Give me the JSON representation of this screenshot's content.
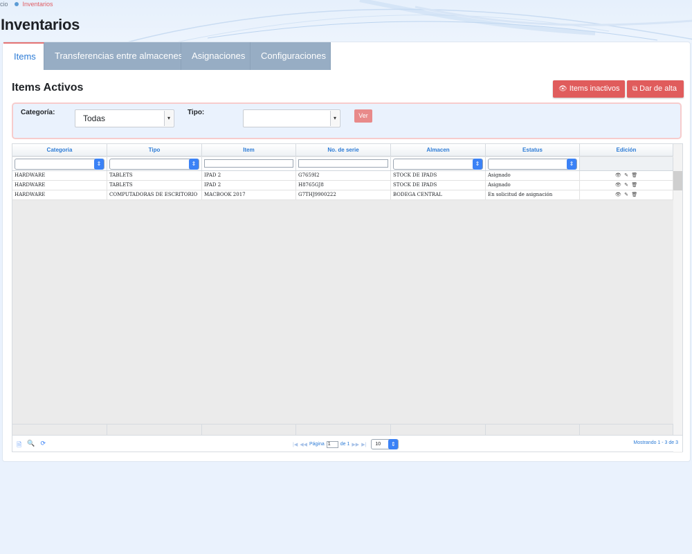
{
  "breadcrumb": {
    "home": "cio",
    "current": "Inventarios"
  },
  "page": {
    "title": "Inventarios"
  },
  "tabs": [
    {
      "label": "Items",
      "active": true
    },
    {
      "label": "Transferencias entre almacenes",
      "active": false
    },
    {
      "label": "Asignaciones",
      "active": false
    },
    {
      "label": "Configuraciones",
      "active": false
    }
  ],
  "section": {
    "title": "Items Activos"
  },
  "actions": {
    "inactive_label": "Items inactivos",
    "inactive_icon": "eye-icon",
    "alta_label": "Dar de alta",
    "alta_icon": "external-link-icon"
  },
  "filters": {
    "categoria_label": "Categoría:",
    "categoria_value": "Todas",
    "tipo_label": "Tipo:",
    "tipo_value": "",
    "ver_label": "Ver"
  },
  "grid": {
    "columns": [
      "Categoria",
      "Tipo",
      "Item",
      "No. de serie",
      "Almacen",
      "Estatus",
      "Edición"
    ],
    "rows": [
      [
        "HARDWARE",
        "TABLETS",
        "IPAD 2",
        "G7659I2",
        "STOCK DE IPADS",
        "Asignado"
      ],
      [
        "HARDWARE",
        "TABLETS",
        "IPAD 2",
        "H8765GJ8",
        "STOCK DE IPADS",
        "Asignado"
      ],
      [
        "HARDWARE",
        "COMPUTADORAS DE ESCRITORIO",
        "MACBOOK 2017",
        "G7THJ9900222",
        "BODEGA CENTRAL",
        "En solicitud de asignación"
      ]
    ]
  },
  "pager": {
    "page_label": "Página",
    "page_value": "1",
    "of_label": "de 1",
    "rows_value": "10",
    "status": "Mostrando 1 - 3 de 3"
  },
  "colors": {
    "accent_blue": "#2c7bd6",
    "button_red": "#e05c5c",
    "tab_inactive": "#97adc4",
    "breadcrumb_active": "#e05c63"
  }
}
